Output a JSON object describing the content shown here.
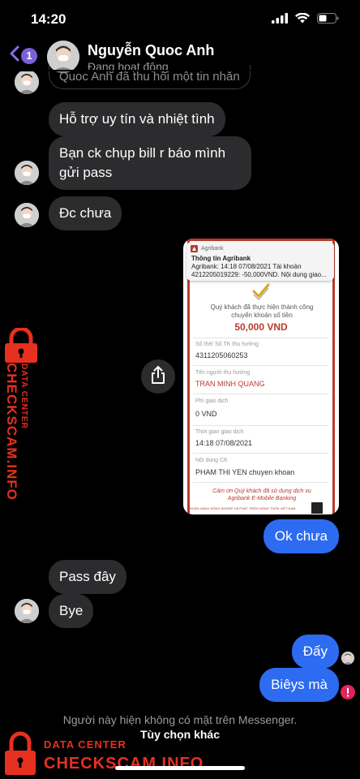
{
  "status_bar": {
    "time": "14:20"
  },
  "header": {
    "back_badge": "1",
    "contact_name": "Nguyễn Quoc Anh",
    "contact_status": "Đang hoạt động"
  },
  "messages": {
    "system_partial": "Quoc Anh đã thu hồi một tin nhắn",
    "m1": "Hỗ trợ uy tín và nhiệt tình",
    "m2": "Bạn ck chụp bill r báo mình gửi pass",
    "m3": "Đc chưa",
    "m4": "Ok chưa",
    "m5": "Pass đây",
    "m6": "Bye",
    "m7": "Đấy",
    "m8": "Biêys mà"
  },
  "receipt": {
    "notif_app": "Agribank",
    "notif_title": "Thông tin Agribank",
    "notif_body": "Agribank: 14:18 07/08/2021 Tài khoản 4212205019229: -50,000VND. Nội dung giao...",
    "success_text": "Quý khách đã thực hiện thành công chuyển khoản số tiền",
    "amount": "50,000 VND",
    "account_label": "Số thẻ/ Số TK thụ hưởng",
    "account_value": "4311205060253",
    "recipient_label": "Tên người thụ hưởng",
    "recipient_value": "TRAN MINH QUANG",
    "fee_label": "Phí giao dịch",
    "fee_value": "0 VND",
    "time_label": "Thời gian giao dịch",
    "time_value": "14:18 07/08/2021",
    "content_label": "Nội dung CK",
    "content_value": "PHAM THI YEN chuyen khoan",
    "thanks": "Cảm ơn Quý khách đã sử dụng dịch vụ Agribank E-Mobile Banking",
    "footer": "NGÂN HÀNG NÔNG NGHIỆP VÀ PHÁT TRIỂN NÔNG THÔN VIỆT NAM"
  },
  "footer": {
    "note": "Người này hiện không có mặt trên Messenger.",
    "option": "Tùy chọn khác"
  },
  "watermark": {
    "data_center": "DATA CENTER",
    "brand": "CHECKSCAM.INFO"
  },
  "colors": {
    "outgoing_bubble": "#2d6cf0",
    "incoming_bubble": "#2c2c2e",
    "watermark_red": "#e63020",
    "badge_purple": "#7b61d9",
    "error_red": "#e0245e"
  }
}
